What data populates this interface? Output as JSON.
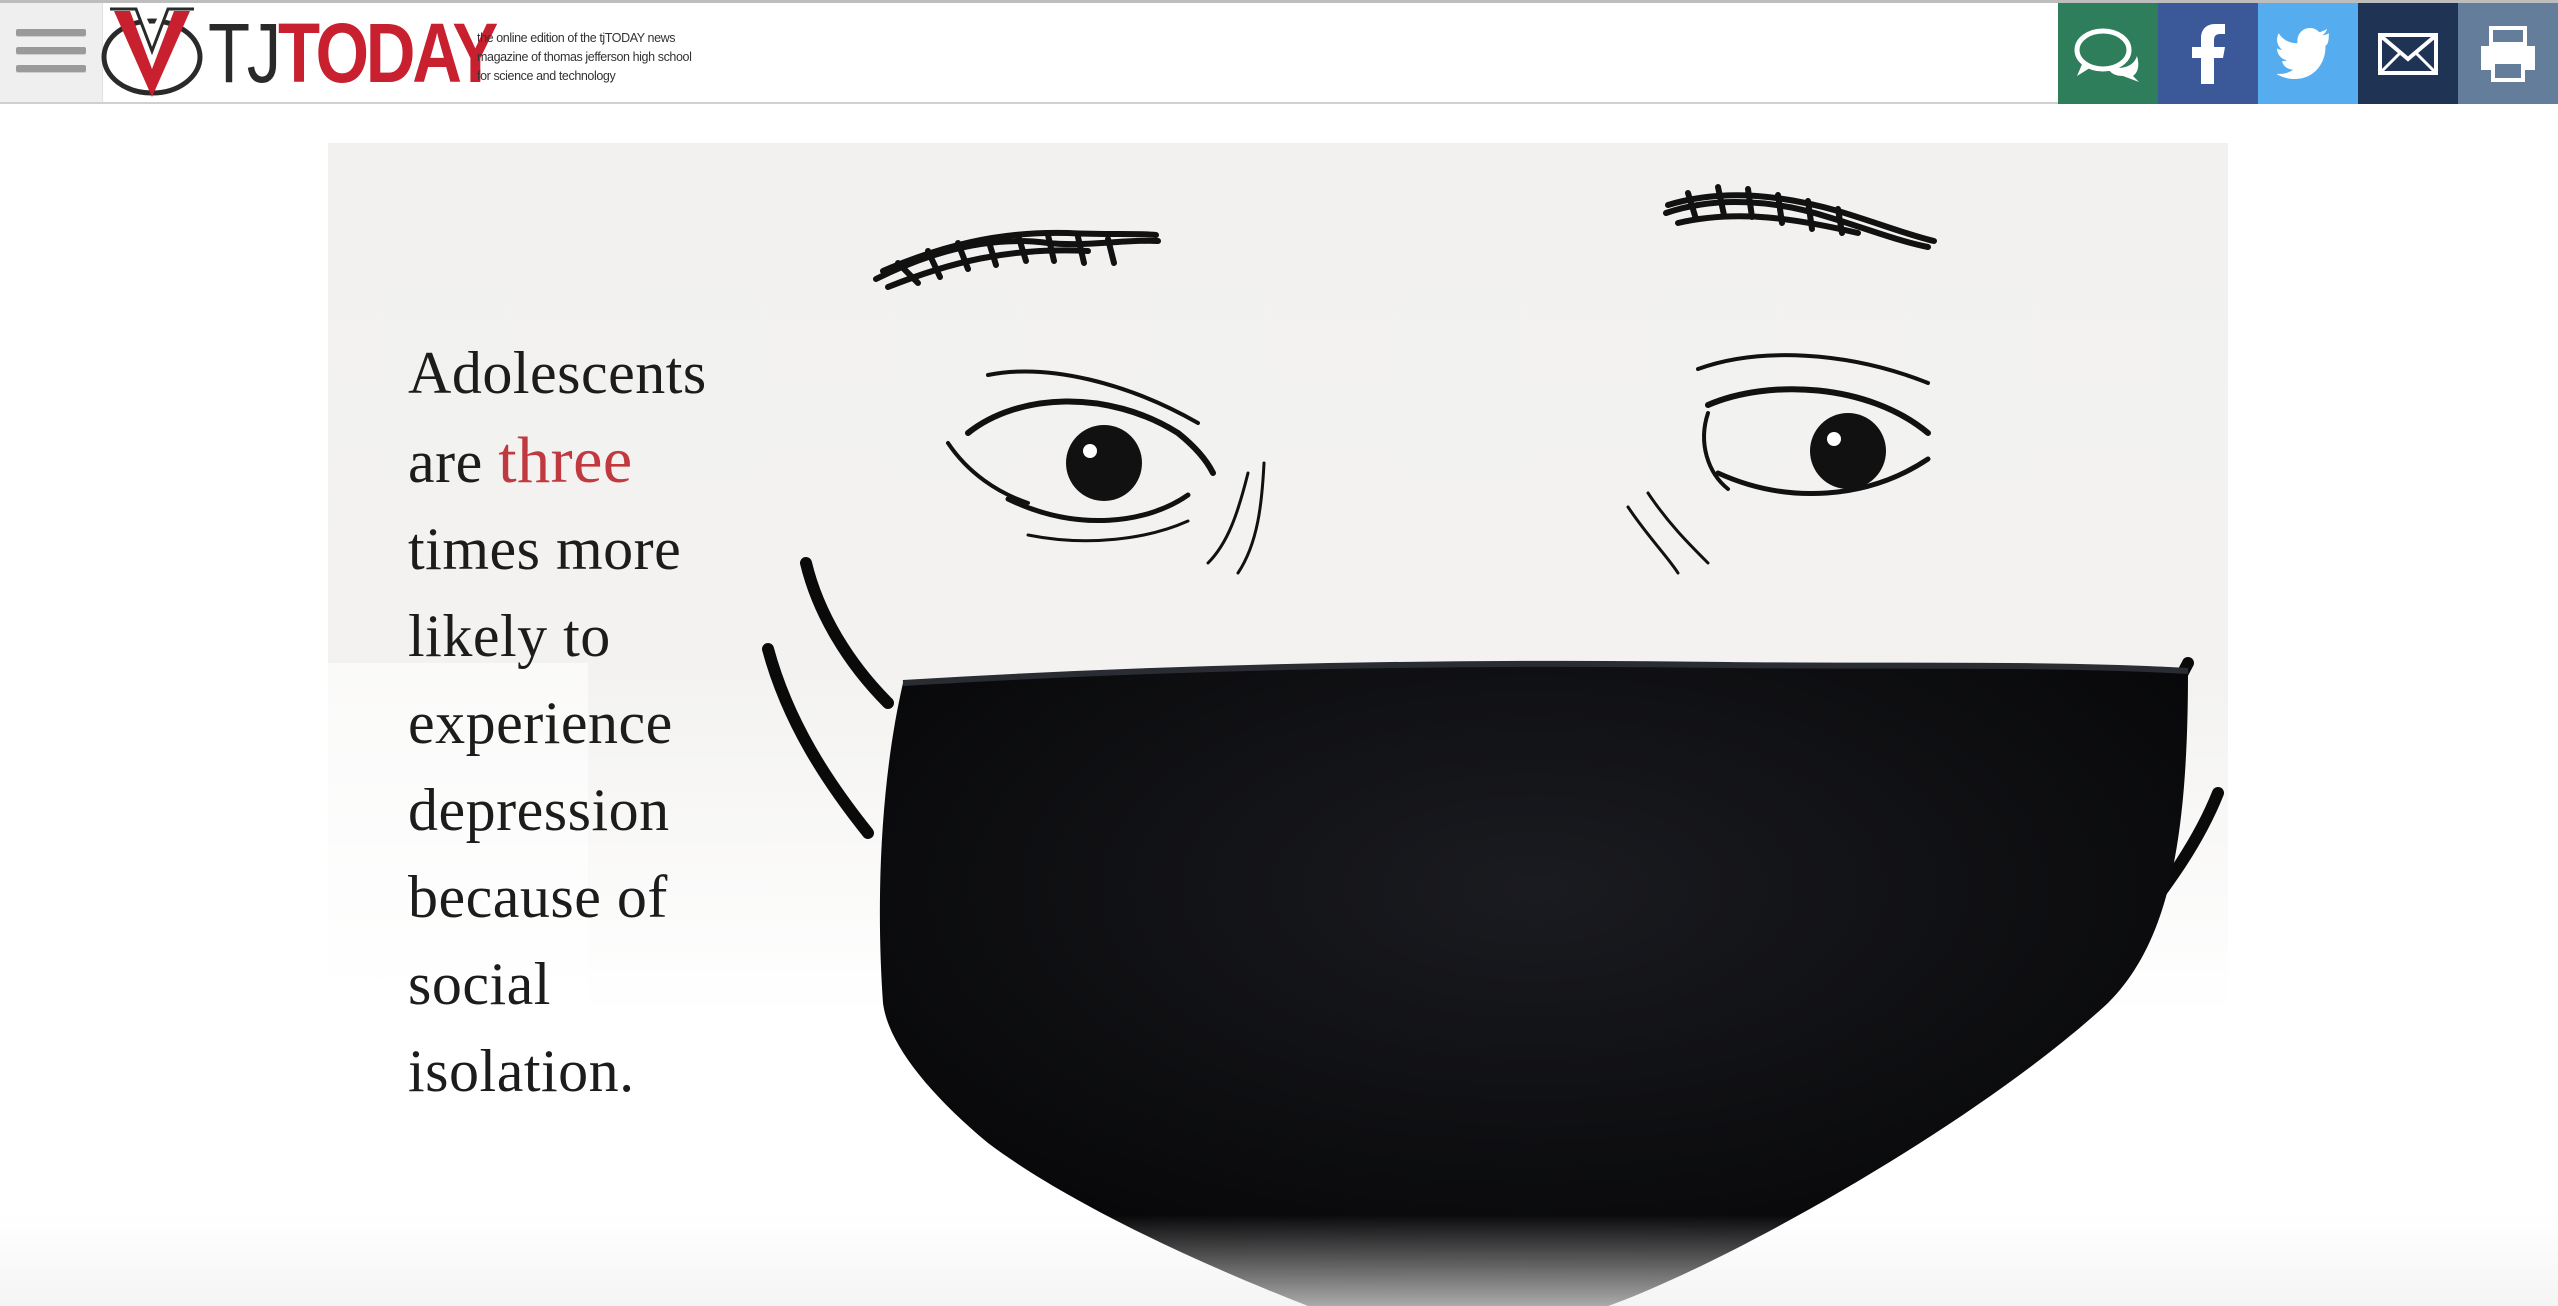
{
  "header": {
    "logo": {
      "tj": "TJ",
      "today": "TODAY"
    },
    "tagline": [
      "the online edition of the tjTODAY news",
      "magazine of thomas jefferson high school",
      "for science and technology"
    ],
    "share": [
      {
        "name": "comments",
        "icon": "comments-icon",
        "color": "#2e7d5b"
      },
      {
        "name": "facebook",
        "icon": "facebook-icon",
        "color": "#3b5998"
      },
      {
        "name": "twitter",
        "icon": "twitter-icon",
        "color": "#55acee"
      },
      {
        "name": "email",
        "icon": "email-icon",
        "color": "#1f3354"
      },
      {
        "name": "print",
        "icon": "print-icon",
        "color": "#647d9b"
      }
    ]
  },
  "hero": {
    "quote": {
      "line1": "Adolescents",
      "line2_pre": "are ",
      "line2_accent": "three",
      "rest": [
        "times more",
        "likely to",
        "experience",
        "depression",
        "because of",
        "social",
        "isolation."
      ]
    },
    "accent_color": "#c0393f"
  },
  "colors": {
    "brand_red": "#c8202f"
  }
}
